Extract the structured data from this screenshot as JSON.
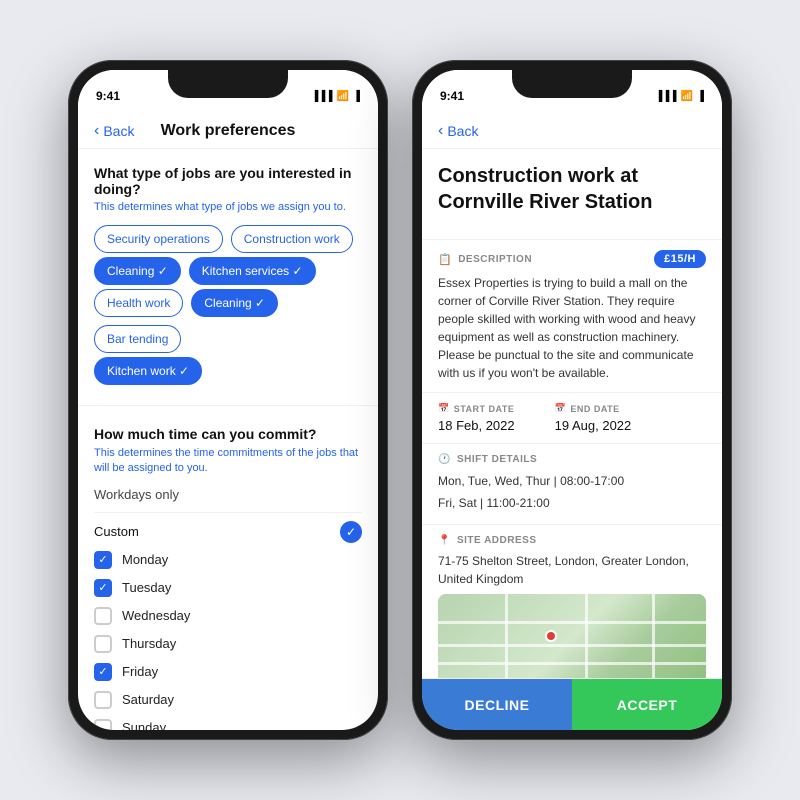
{
  "phone1": {
    "status_time": "9:41",
    "nav": {
      "back_label": "Back",
      "title": "Work preferences"
    },
    "section1": {
      "title": "What type of jobs are you interested in doing?",
      "subtitle": "This determines what type of jobs we assign you to.",
      "tags": [
        {
          "label": "Security operations",
          "selected": false
        },
        {
          "label": "Construction work",
          "selected": false
        },
        {
          "label": "Cleaning",
          "selected": true
        },
        {
          "label": "Kitchen services",
          "selected": true
        },
        {
          "label": "Health work",
          "selected": false
        },
        {
          "label": "Cleaning",
          "selected": true
        },
        {
          "label": "Bar tending",
          "selected": false
        },
        {
          "label": "Kitchen work",
          "selected": true
        }
      ]
    },
    "section2": {
      "title": "How much time can you commit?",
      "subtitle": "This determines the time commitments of the jobs that will be assigned to you.",
      "workdays_label": "Workdays only",
      "custom_label": "Custom",
      "days": [
        {
          "label": "Monday",
          "checked": true
        },
        {
          "label": "Tuesday",
          "checked": true
        },
        {
          "label": "Wednesday",
          "checked": false
        },
        {
          "label": "Thursday",
          "checked": false
        },
        {
          "label": "Friday",
          "checked": true
        },
        {
          "label": "Saturday",
          "checked": false
        },
        {
          "label": "Sunday",
          "checked": false
        }
      ]
    }
  },
  "phone2": {
    "status_time": "9:41",
    "nav": {
      "back_label": "Back"
    },
    "job": {
      "title": "Construction work at Cornville River Station",
      "description_label": "DESCRIPTION",
      "price_badge": "£15/h",
      "description_text": "Essex Properties is trying to build a mall on the corner of Corville River Station. They require people skilled with working with wood and heavy equipment as well as construction machinery. Please be punctual to the site and communicate with us if you won't be available.",
      "start_date_label": "START DATE",
      "start_date": "18 Feb, 2022",
      "end_date_label": "END DATE",
      "end_date": "19 Aug, 2022",
      "shift_label": "SHIFT DETAILS",
      "shift_line1": "Mon, Tue, Wed, Thur | 08:00-17:00",
      "shift_line2": "Fri, Sat | 11:00-21:00",
      "address_label": "SITE ADDRESS",
      "address_text": "71-75 Shelton Street, London, Greater London, United Kingdom"
    },
    "actions": {
      "decline": "DECLINE",
      "accept": "ACCEPT"
    }
  }
}
